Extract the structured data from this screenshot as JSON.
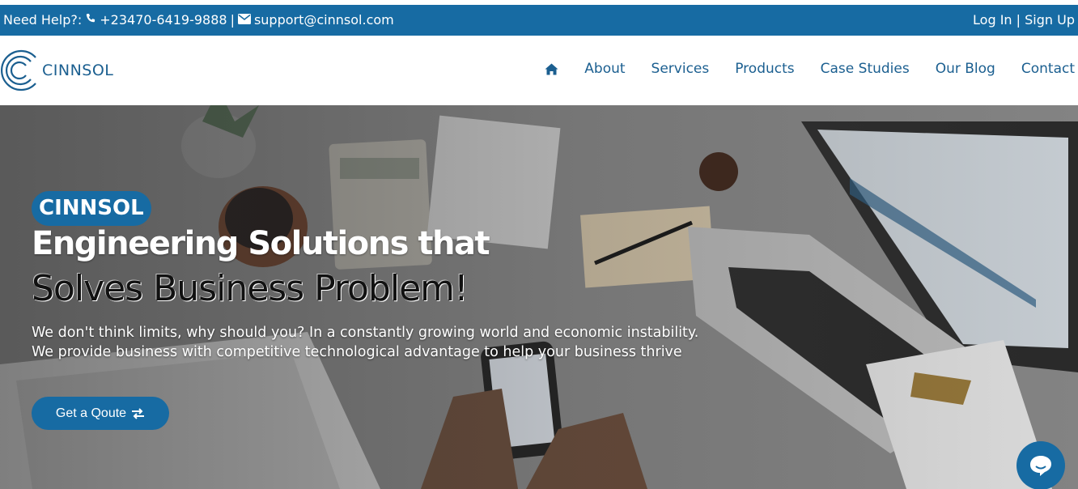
{
  "topbar": {
    "help_label": "Need Help?:",
    "phone": "+23470-6419-9888",
    "separator": "|",
    "email": "support@cinnsol.com",
    "login": "Log In",
    "auth_separator": "|",
    "signup": "Sign Up"
  },
  "brand": {
    "name": "CINNSOL"
  },
  "nav": {
    "home_icon": "home-icon",
    "items": [
      "About",
      "Services",
      "Products",
      "Case Studies",
      "Our Blog",
      "Contact"
    ]
  },
  "hero": {
    "badge": "CINNSOL",
    "headline_1": "Engineering Solutions that",
    "headline_2": "Solves Business Problem!",
    "description": "We don't think limits, why should you? In a constantly growing world and economic instability. We provide business with competitive technological advantage to help your business thrive",
    "cta_label": "Get a Qoute",
    "cta_icon": "exchange-icon"
  },
  "chat": {
    "icon": "chat-bubble-icon"
  },
  "colors": {
    "brand_blue": "#176ba3",
    "nav_text": "#1b5f90"
  }
}
